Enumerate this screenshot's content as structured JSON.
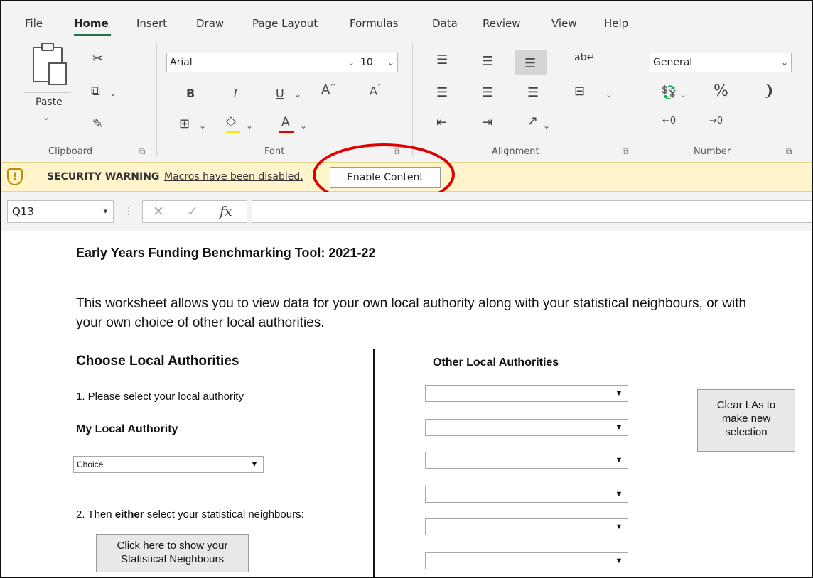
{
  "menu": {
    "tabs": [
      "File",
      "Home",
      "Insert",
      "Draw",
      "Page Layout",
      "Formulas",
      "Data",
      "Review",
      "View",
      "Help"
    ],
    "active": "Home"
  },
  "ribbon": {
    "clipboard": {
      "paste_label": "Paste",
      "group_label": "Clipboard"
    },
    "font": {
      "font_name": "Arial",
      "font_size": "10",
      "group_label": "Font",
      "bold": "B",
      "italic": "I",
      "underline": "U"
    },
    "alignment": {
      "group_label": "Alignment"
    },
    "number": {
      "format": "General",
      "group_label": "Number",
      "percent": "%",
      "comma": "❩"
    }
  },
  "security_bar": {
    "title": "SECURITY WARNING",
    "message": "Macros have been disabled.",
    "button": "Enable Content"
  },
  "formula_bar": {
    "name_box": "Q13",
    "cancel": "✕",
    "enter": "✓",
    "fx": "fx",
    "value": ""
  },
  "sheet": {
    "title": "Early Years Funding Benchmarking Tool: 2021-22",
    "description": "This worksheet allows you to view data for your own local authority along with your statistical neighbours, or with your own choice of other local authorities.",
    "choose_heading": "Choose Local Authorities",
    "step1": "1. Please select your local authority",
    "my_la_heading": "My Local Authority",
    "my_la_value": "Choice",
    "step2_pre": "2. Then ",
    "step2_bold": "either",
    "step2_post": " select your statistical neighbours:",
    "show_neighbours_button": "Click here to show your Statistical Neighbours",
    "other_heading": "Other Local Authorities",
    "other_las": [
      "",
      "",
      "",
      "",
      "",
      ""
    ],
    "clear_button": "Clear LAs to make new selection"
  },
  "colors": {
    "accent": "#217346",
    "warning_bg": "#fff4cc",
    "highlight_ring": "#e00000",
    "font_color_bar": "#e00000",
    "fill_color_bar": "#ffe600"
  }
}
